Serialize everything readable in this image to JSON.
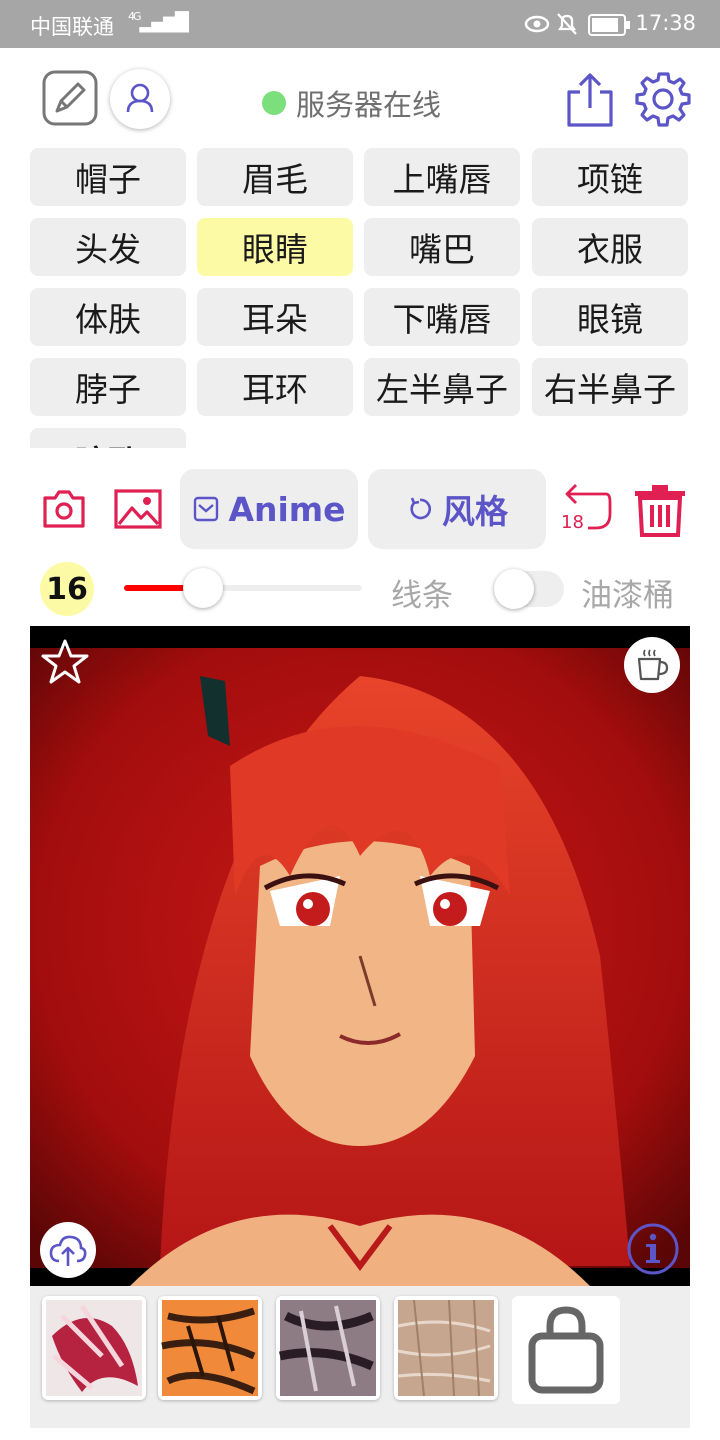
{
  "status_bar": {
    "carrier": "中国联通",
    "network": "4G",
    "time": "17:38"
  },
  "header": {
    "server_status": "服务器在线"
  },
  "tags": [
    {
      "label": "帽子",
      "selected": false
    },
    {
      "label": "眉毛",
      "selected": false
    },
    {
      "label": "上嘴唇",
      "selected": false
    },
    {
      "label": "项链",
      "selected": false
    },
    {
      "label": "头发",
      "selected": false
    },
    {
      "label": "眼睛",
      "selected": true
    },
    {
      "label": "嘴巴",
      "selected": false
    },
    {
      "label": "衣服",
      "selected": false
    },
    {
      "label": "体肤",
      "selected": false
    },
    {
      "label": "耳朵",
      "selected": false
    },
    {
      "label": "下嘴唇",
      "selected": false
    },
    {
      "label": "眼镜",
      "selected": false
    },
    {
      "label": "脖子",
      "selected": false
    },
    {
      "label": "耳环",
      "selected": false
    },
    {
      "label": "左半鼻子",
      "selected": false
    },
    {
      "label": "右半鼻子",
      "selected": false
    },
    {
      "label": "瞳孔",
      "selected": false
    }
  ],
  "toolbar": {
    "camera_icon": "camera-icon",
    "gallery_icon": "image-icon",
    "model_button": "Anime",
    "style_button": "风格",
    "undo_count": "18",
    "delete_icon": "trash-icon"
  },
  "brush": {
    "size": "16",
    "slider_value": 0.33,
    "line_label": "线条",
    "paint_bucket_label": "油漆桶",
    "paint_bucket_on": false
  },
  "canvas": {
    "favorite_icon": "star-icon",
    "coffee_icon": "coffee-icon",
    "upload_icon": "cloud-upload-icon",
    "info_icon": "info-icon"
  },
  "styles_strip": {
    "items": [
      "style-1",
      "style-2",
      "style-3",
      "style-4"
    ],
    "shop_icon": "shopping-bag-icon"
  },
  "colors": {
    "accent_red": "#e01f52",
    "accent_purple": "#5b55c8",
    "selected_tag": "#fdfaa6"
  }
}
